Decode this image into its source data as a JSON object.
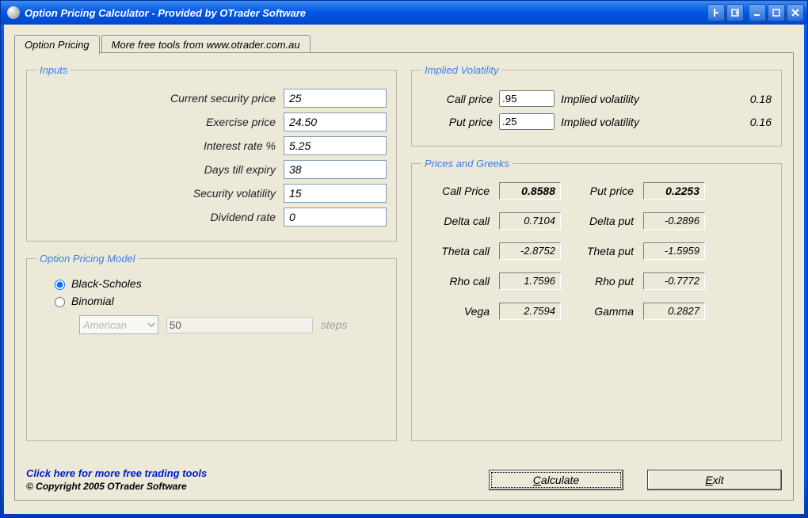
{
  "window": {
    "title": "Option Pricing Calculator - Provided by OTrader Software"
  },
  "tabs": [
    {
      "label": "Option Pricing",
      "active": true
    },
    {
      "label": "More free tools from www.otrader.com.au",
      "active": false
    }
  ],
  "inputs_group": {
    "legend": "Inputs",
    "fields": {
      "current_security_price": {
        "label": "Current security price",
        "value": "25"
      },
      "exercise_price": {
        "label": "Exercise price",
        "value": "24.50"
      },
      "interest_rate": {
        "label": "Interest rate %",
        "value": "5.25"
      },
      "days_till_expiry": {
        "label": "Days till expiry",
        "value": "38"
      },
      "security_volatility": {
        "label": "Security volatility",
        "value": "15"
      },
      "dividend_rate": {
        "label": "Dividend rate",
        "value": "0"
      }
    }
  },
  "model_group": {
    "legend": "Option Pricing Model",
    "black_scholes_label": "Black-Scholes",
    "binomial_label": "Binomial",
    "selected": "black_scholes",
    "exercise_style": "American",
    "steps_value": "50",
    "steps_label": "steps"
  },
  "iv_group": {
    "legend": "Implied Volatility",
    "call_price_label": "Call price",
    "call_price_value": ".95",
    "call_iv_label": "Implied volatility",
    "call_iv_value": "0.18",
    "put_price_label": "Put price",
    "put_price_value": ".25",
    "put_iv_label": "Implied volatility",
    "put_iv_value": "0.16"
  },
  "greeks_group": {
    "legend": "Prices and Greeks",
    "rows": {
      "call_price": {
        "label": "Call Price",
        "value": "0.8588"
      },
      "put_price": {
        "label": "Put price",
        "value": "0.2253"
      },
      "delta_call": {
        "label": "Delta call",
        "value": "0.7104"
      },
      "delta_put": {
        "label": "Delta put",
        "value": "-0.2896"
      },
      "theta_call": {
        "label": "Theta call",
        "value": "-2.8752"
      },
      "theta_put": {
        "label": "Theta put",
        "value": "-1.5959"
      },
      "rho_call": {
        "label": "Rho call",
        "value": "1.7596"
      },
      "rho_put": {
        "label": "Rho put",
        "value": "-0.7772"
      },
      "vega": {
        "label": "Vega",
        "value": "2.7594"
      },
      "gamma": {
        "label": "Gamma",
        "value": "0.2827"
      }
    }
  },
  "footer": {
    "link_text": "Click here for more free trading tools",
    "copyright": "© Copyright 2005 OTrader Software",
    "calc_prefix": "C",
    "calc_rest": "alculate",
    "exit_prefix": "E",
    "exit_rest": "xit"
  }
}
